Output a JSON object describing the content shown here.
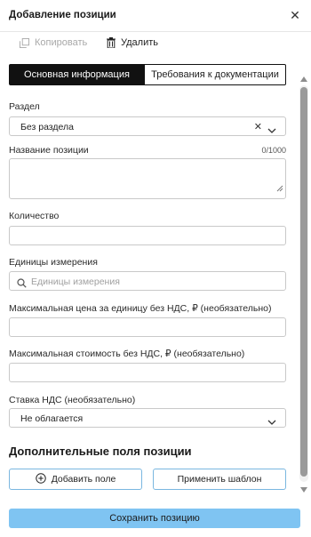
{
  "header": {
    "title": "Добавление позиции",
    "close_icon": "close-icon"
  },
  "toolbar": {
    "copy_label": "Копировать",
    "delete_label": "Удалить"
  },
  "tabs": [
    {
      "label": "Основная информация",
      "active": true
    },
    {
      "label": "Требования к документации",
      "active": false
    }
  ],
  "section": {
    "label": "Раздел",
    "value": "Без раздела"
  },
  "name": {
    "label": "Название позиции",
    "value": "",
    "counter": "0/1000"
  },
  "quantity": {
    "label": "Количество",
    "value": ""
  },
  "units": {
    "label": "Единицы измерения",
    "placeholder": "Единицы измерения"
  },
  "max_unit_price": {
    "label": "Максимальная цена за единицу без НДС, ₽ (необязательно)",
    "value": ""
  },
  "max_total_cost": {
    "label": "Максимальная стоимость без НДС, ₽ (необязательно)",
    "value": ""
  },
  "vat_rate": {
    "label": "Ставка НДС (необязательно)",
    "value": "Не облагается"
  },
  "extra_fields": {
    "title": "Дополнительные поля позиции",
    "add_field_label": "Добавить поле",
    "apply_template_label": "Применить шаблон"
  },
  "footer": {
    "save_label": "Сохранить позицию"
  },
  "colors": {
    "primary_button": "#7fc4f2",
    "active_tab": "#111111",
    "outline_button_border": "#7ab7e0"
  }
}
